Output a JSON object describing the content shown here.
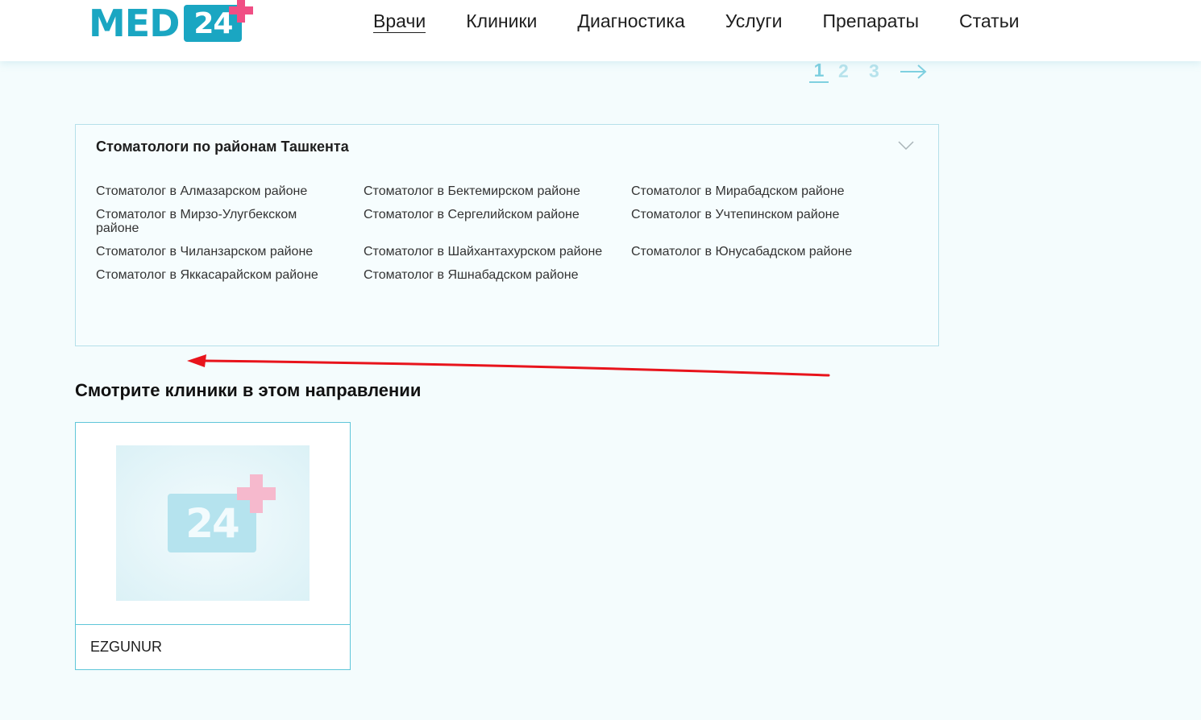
{
  "header": {
    "logo": {
      "text": "MED",
      "number": "24"
    },
    "nav": [
      {
        "label": "Врачи",
        "active": true
      },
      {
        "label": "Клиники"
      },
      {
        "label": "Диагностика"
      },
      {
        "label": "Услуги"
      },
      {
        "label": "Препараты"
      },
      {
        "label": "Статьи"
      }
    ]
  },
  "pagination": {
    "pages": [
      "1",
      "2",
      "3"
    ],
    "current": "1",
    "next_icon": "arrow-right-icon"
  },
  "districts": {
    "title": "Стоматологи по районам Ташкента",
    "toggle_icon": "chevron-down-icon",
    "links": [
      "Стоматолог в Алмазарском районе",
      "Стоматолог в Бектемирском районе",
      "Стоматолог в Мирабадском районе",
      "Стоматолог в Мирзо-Улугбекском районе",
      "Стоматолог в Сергелийском районе",
      "Стоматолог в Учтепинском районе",
      "Стоматолог в Чиланзарском районе",
      "Стоматолог в Шайхантахурском районе",
      "Стоматолог в Юнусабадском районе",
      "Стоматолог в Яккасарайском районе",
      "Стоматолог в Яшнабадском районе"
    ]
  },
  "clinics": {
    "title": "Смотрите клиники в этом направлении",
    "items": [
      {
        "name": "EZGUNUR",
        "image_placeholder": {
          "number": "24"
        }
      }
    ]
  },
  "colors": {
    "brand": "#1aa6c2",
    "accent_plus": "#f04e84",
    "page_bg": "#f4fcfd",
    "annotation_arrow": "#e8141c"
  }
}
